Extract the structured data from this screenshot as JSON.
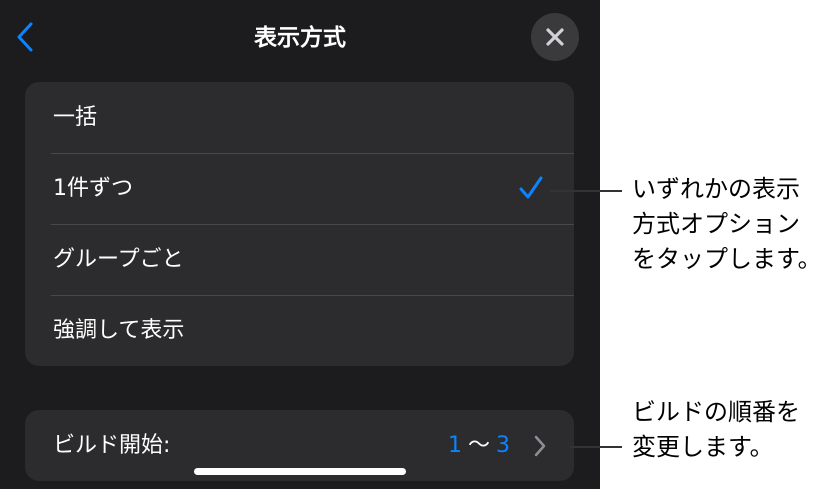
{
  "header": {
    "title": "表示方式"
  },
  "options": [
    {
      "label": "一括",
      "selected": false
    },
    {
      "label": "1件ずつ",
      "selected": true
    },
    {
      "label": "グループごと",
      "selected": false
    },
    {
      "label": "強調して表示",
      "selected": false
    }
  ],
  "build": {
    "label": "ビルド開始:",
    "from": "1",
    "tilde": "〜",
    "to": "3"
  },
  "callouts": {
    "option": [
      "いずれかの表示",
      "方式オプション",
      "をタップします。"
    ],
    "build": [
      "ビルドの順番を",
      "変更します。"
    ]
  },
  "colors": {
    "accent": "#0a84ff",
    "panel": "#1c1c1e",
    "card": "#2c2c2e"
  },
  "icons": {
    "back": "chevron-left-icon",
    "close": "close-icon",
    "check": "checkmark-icon",
    "disclosure": "chevron-right-icon"
  }
}
